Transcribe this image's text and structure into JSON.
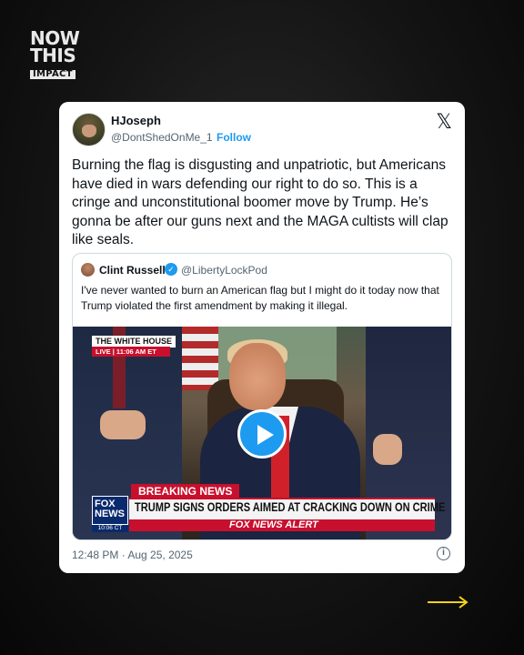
{
  "brand": {
    "line1": "NOW",
    "line2": "THIS",
    "line3": "IMPACT"
  },
  "tweet": {
    "display_name": "HJoseph",
    "handle": "@DontShedOnMe_1",
    "separator": "·",
    "follow_label": "Follow",
    "platform_icon": "x-logo-icon",
    "text": "Burning the flag is disgusting and unpatriotic, but Americans have died in wars defending our right to do so. This is a cringe and unconstitutional boomer move by Trump. He’s gonna be after our guns next and the MAGA cultists will clap like seals.",
    "timestamp": "12:48 PM · Aug 25, 2025"
  },
  "quote": {
    "display_name": "Clint Russell",
    "handle": "@LibertyLockPod",
    "text": "I've never wanted to burn an American flag but I might do it today now that Trump violated the first amendment by making it illegal."
  },
  "video": {
    "location_label": "THE WHITE HOUSE",
    "live_label": "LIVE | 11:06 AM ET",
    "breaking_label": "BREAKING NEWS",
    "headline": "TRUMP SIGNS ORDERS AIMED AT CRACKING DOWN ON CRIME",
    "alert_label": "FOX NEWS ALERT",
    "channel_logo": "FOX NEWS",
    "channel_time": "10:06 CT"
  },
  "colors": {
    "accent": "#1d9bf0",
    "arrow": "#f2d21b",
    "news_red": "#c8102e",
    "background": "#111111"
  }
}
